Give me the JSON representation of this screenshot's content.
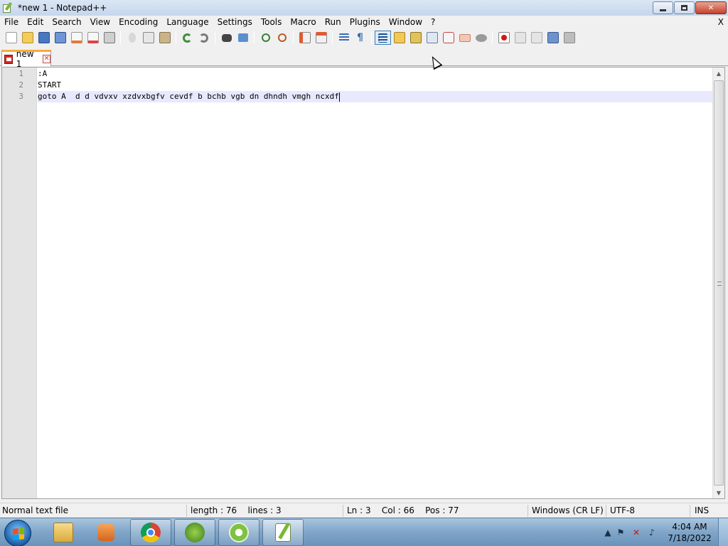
{
  "window": {
    "title": "*new 1 - Notepad++",
    "app_icon": "notepad-plus-plus-icon"
  },
  "menu": {
    "items": [
      "File",
      "Edit",
      "Search",
      "View",
      "Encoding",
      "Language",
      "Settings",
      "Tools",
      "Macro",
      "Run",
      "Plugins",
      "Window",
      "?"
    ],
    "close": "X"
  },
  "toolbar": {
    "icons": [
      "new-file-icon",
      "open-file-icon",
      "save-icon",
      "save-all-icon",
      "close-icon",
      "close-all-icon",
      "print-icon",
      "cut-icon",
      "copy-icon",
      "paste-icon",
      "undo-icon",
      "redo-icon",
      "find-icon",
      "replace-icon",
      "zoom-in-icon",
      "zoom-out-icon",
      "sync-vertical-icon",
      "sync-horizontal-icon",
      "word-wrap-icon",
      "show-all-chars-icon",
      "indent-guide-icon",
      "user-language-icon",
      "doc-map-icon",
      "function-list-icon",
      "folder-workspace-icon",
      "monitoring-icon",
      "record-macro-icon",
      "stop-record-icon",
      "playback-macro-icon",
      "run-macro-multiple-icon",
      "save-macro-icon"
    ]
  },
  "tabs": [
    {
      "label": "new 1",
      "close": "✕"
    }
  ],
  "editor": {
    "lines": [
      {
        "num": "1",
        "text": ":A"
      },
      {
        "num": "2",
        "text": "START"
      },
      {
        "num": "3",
        "text": "goto A  d d vdvxv xzdvxbgfv cevdf b bchb vgb dn dhndh vmgh ncxdf"
      }
    ],
    "current_line": 3
  },
  "status": {
    "file_type": "Normal text file",
    "length": "length : 76    lines : 3",
    "position": "Ln : 3    Col : 66    Pos : 77",
    "eol": "Windows (CR LF)",
    "encoding": "UTF-8",
    "mode": "INS"
  },
  "taskbar": {
    "apps": [
      "file-explorer-icon",
      "media-player-icon",
      "chrome-icon",
      "windows-app-icon",
      "green-app-icon",
      "notepad-plus-plus-icon"
    ],
    "clock_time": "4:04 AM",
    "clock_date": "7/18/2022"
  },
  "colors": {
    "tab_accent": "#faaa3c",
    "current_line_bg": "#e8e8ff",
    "gutter_bg": "#e4e4e4"
  }
}
